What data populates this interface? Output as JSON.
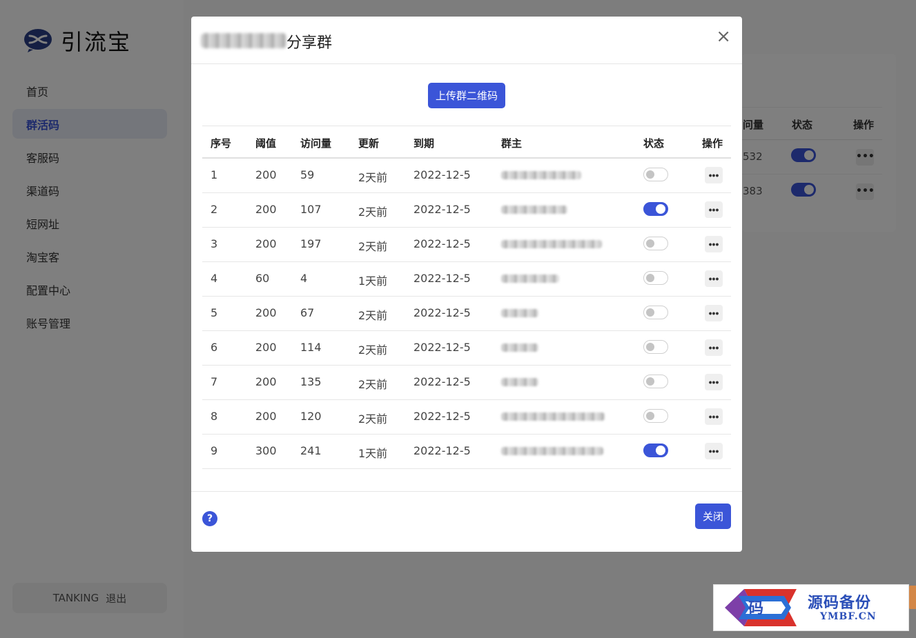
{
  "app": {
    "name": "引流宝"
  },
  "sidebar": {
    "items": [
      {
        "label": "首页",
        "active": false
      },
      {
        "label": "群活码",
        "active": true
      },
      {
        "label": "客服码",
        "active": false
      },
      {
        "label": "渠道码",
        "active": false
      },
      {
        "label": "短网址",
        "active": false
      },
      {
        "label": "淘宝客",
        "active": false
      },
      {
        "label": "配置中心",
        "active": false
      },
      {
        "label": "账号管理",
        "active": false
      }
    ],
    "account": {
      "username": "TANKING",
      "logout_label": "退出"
    }
  },
  "background_table": {
    "headers": {
      "visits_partial": "问量",
      "status": "状态",
      "actions": "操作"
    },
    "rows": [
      {
        "visits_partial": "532",
        "enabled": true
      },
      {
        "visits_partial": "383",
        "enabled": true
      }
    ]
  },
  "modal": {
    "title_suffix": "分享群",
    "close_icon": "×",
    "upload_button": "上传群二维码",
    "columns": {
      "index": "序号",
      "threshold": "阈值",
      "visits": "访问量",
      "updated": "更新",
      "expiry": "到期",
      "owner": "群主",
      "status": "状态",
      "actions": "操作"
    },
    "rows": [
      {
        "index": "1",
        "threshold": "200",
        "visits": "59",
        "updated": "2天前",
        "expiry": "2022-12-5",
        "enabled": false
      },
      {
        "index": "2",
        "threshold": "200",
        "visits": "107",
        "updated": "2天前",
        "expiry": "2022-12-5",
        "enabled": true
      },
      {
        "index": "3",
        "threshold": "200",
        "visits": "197",
        "updated": "2天前",
        "expiry": "2022-12-5",
        "enabled": false
      },
      {
        "index": "4",
        "threshold": "60",
        "visits": "4",
        "updated": "1天前",
        "expiry": "2022-12-5",
        "enabled": false
      },
      {
        "index": "5",
        "threshold": "200",
        "visits": "67",
        "updated": "2天前",
        "expiry": "2022-12-5",
        "enabled": false
      },
      {
        "index": "6",
        "threshold": "200",
        "visits": "114",
        "updated": "2天前",
        "expiry": "2022-12-5",
        "enabled": false
      },
      {
        "index": "7",
        "threshold": "200",
        "visits": "135",
        "updated": "2天前",
        "expiry": "2022-12-5",
        "enabled": false
      },
      {
        "index": "8",
        "threshold": "200",
        "visits": "120",
        "updated": "2天前",
        "expiry": "2022-12-5",
        "enabled": false
      },
      {
        "index": "9",
        "threshold": "300",
        "visits": "241",
        "updated": "1天前",
        "expiry": "2022-12-5",
        "enabled": true
      }
    ],
    "more_icon": "•••",
    "help_icon": "?",
    "close_button": "关闭"
  },
  "watermark": {
    "badge_char": "码",
    "cn": "源码备份",
    "en": "YMBF.CN"
  },
  "colors": {
    "accent": "#3b55d8",
    "overlay": "rgba(0,0,0,0.5)"
  },
  "icons": [
    "app-logo-icon",
    "close-icon",
    "more-icon",
    "help-icon"
  ]
}
